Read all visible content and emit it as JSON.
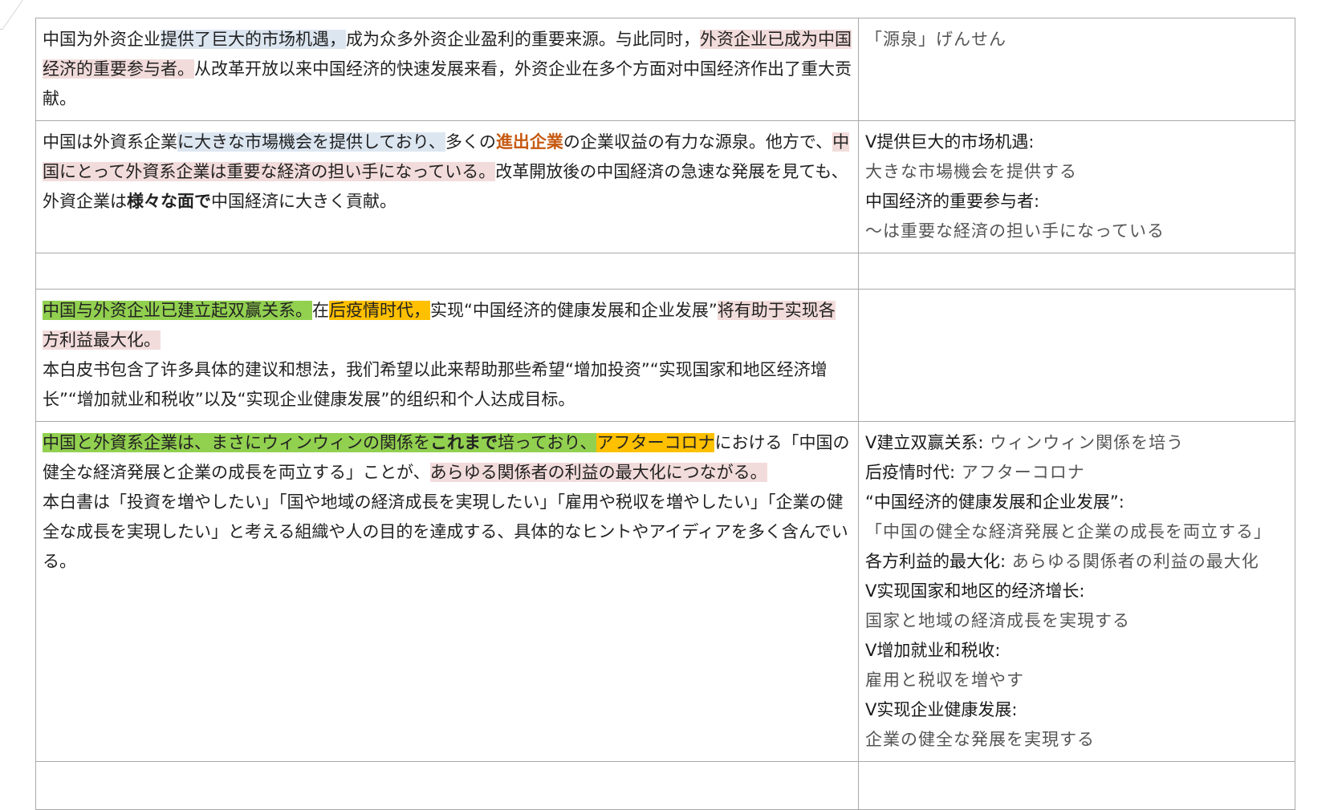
{
  "rows": [
    {
      "left": {
        "segments": [
          {
            "text": "中国为外资企业",
            "style": ""
          },
          {
            "text": "提供了巨大的市场机遇，",
            "style": "hl-blue"
          },
          {
            "text": "成为众多外资企业盈利的重要来源。与此同时，",
            "style": ""
          },
          {
            "text": "外资企业已成为中国经济的重要参与者。",
            "style": "hl-pink"
          },
          {
            "text": "从改革开放以来中国经济的快速发展来看，外资企业在多个方面对中国经济作出了重大贡献。",
            "style": ""
          }
        ]
      },
      "right": {
        "lines": [
          {
            "label": "",
            "value": "「源泉」げんせん"
          }
        ]
      }
    },
    {
      "left": {
        "segments": [
          {
            "text": "中国は外資系企業",
            "style": ""
          },
          {
            "text": "に大きな市場機会を提供しており、",
            "style": "hl-blue"
          },
          {
            "text": "多くの",
            "style": ""
          },
          {
            "text": "進出企業",
            "style": "t-orange"
          },
          {
            "text": "の企業収益の有力な源泉。他方で、",
            "style": ""
          },
          {
            "text": "中国にとって外資系企業は重要な経済の担い手になっている。",
            "style": "hl-pink"
          },
          {
            "text": "改革開放後の中国経済の急速な発展を見ても、外資企業は",
            "style": ""
          },
          {
            "text": "様々な面で",
            "style": "b"
          },
          {
            "text": "中国経済に大きく貢献。",
            "style": ""
          }
        ]
      },
      "right": {
        "lines": [
          {
            "label": "V提供巨大的市场机遇:",
            "value": ""
          },
          {
            "label": "",
            "value": "大きな市場機会を提供する"
          },
          {
            "label": "中国经济的重要参与者:",
            "value": ""
          },
          {
            "label": "",
            "value": "～は重要な経済の担い手になっている"
          }
        ]
      }
    },
    {
      "left": {
        "segments": []
      },
      "right": {
        "lines": []
      }
    },
    {
      "left": {
        "segments": [
          {
            "text": "中国与外资企业已建立起双赢关系。",
            "style": "hl-green"
          },
          {
            "text": "在",
            "style": ""
          },
          {
            "text": "后疫情时代，",
            "style": "hl-orange"
          },
          {
            "text": "实现“中国经济的健康发展和企业发展”",
            "style": ""
          },
          {
            "text": "将有助于实现各方利益最大化。",
            "style": "hl-pink"
          }
        ],
        "paragraph2": "本白皮书包含了许多具体的建议和想法，我们希望以此来帮助那些希望“增加投资”“实现国家和地区经济增长”“增加就业和税收”以及“实现企业健康发展”的组织和个人达成目标。"
      },
      "right": {
        "lines": []
      }
    },
    {
      "left": {
        "segments": [
          {
            "text": "中国と外資系企業",
            "style": "hl-green"
          },
          {
            "text": "は、まさにウィンウィンの関係を",
            "style": "hl-green"
          },
          {
            "text": "これまで",
            "style": "hl-green b"
          },
          {
            "text": "培っており、",
            "style": "hl-green"
          },
          {
            "text": "アフターコロナ",
            "style": "hl-orange"
          },
          {
            "text": "における「中国の健全な経済発展と企業の成長を両立する」ことが、",
            "style": ""
          },
          {
            "text": "あらゆる関係者の利益の最大化につながる。",
            "style": "hl-pink"
          }
        ],
        "paragraph2": "本白書は「投資を増やしたい」「国や地域の経済成長を実現したい」「雇用や税収を増やしたい」「企業の健全な成長を実現したい」と考える組織や人の目的を達成する、具体的なヒントやアイディアを多く含んでいる。"
      },
      "right": {
        "lines": [
          {
            "label": "V建立双赢关系:",
            "value": "ウィンウィン関係を培う"
          },
          {
            "label": "后疫情时代:",
            "value": "アフターコロナ"
          },
          {
            "label": "“中国经济的健康发展和企业发展”:",
            "value": ""
          },
          {
            "label": "",
            "value": "「中国の健全な経済発展と企業の成長を両立する」"
          },
          {
            "label": "各方利益的最大化:",
            "value": "あらゆる関係者の利益の最大化"
          },
          {
            "label": "V实现国家和地区的经济增长:",
            "value": ""
          },
          {
            "label": "",
            "value": "国家と地域の経済成長を実現する"
          },
          {
            "label": "V增加就业和税收:",
            "value": ""
          },
          {
            "label": "",
            "value": "雇用と税収を増やす"
          },
          {
            "label": "V实现企业健康发展:",
            "value": ""
          },
          {
            "label": "",
            "value": "企業の健全な発展を実現する"
          }
        ]
      }
    },
    {
      "left": {
        "segments": []
      },
      "right": {
        "lines": []
      }
    }
  ]
}
